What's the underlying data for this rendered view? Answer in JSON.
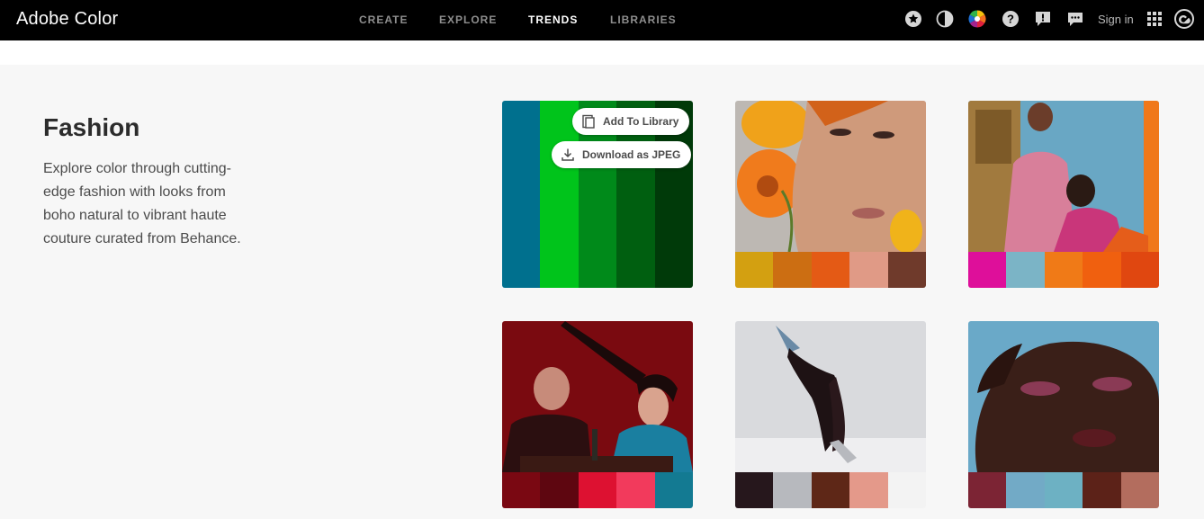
{
  "app": {
    "brand": "Adobe Color"
  },
  "nav": {
    "items": [
      {
        "label": "CREATE",
        "active": false
      },
      {
        "label": "EXPLORE",
        "active": false
      },
      {
        "label": "TRENDS",
        "active": true
      },
      {
        "label": "LIBRARIES",
        "active": false
      }
    ]
  },
  "header_icons": [
    "star-icon",
    "theme-contrast-icon",
    "color-wheel-icon",
    "help-icon",
    "feedback-icon",
    "chat-icon"
  ],
  "header": {
    "signin_label": "Sign in",
    "apps_icon": "apps-grid-icon",
    "cc_icon": "creative-cloud-icon"
  },
  "section": {
    "title": "Fashion",
    "description": "Explore color through cutting-edge fashion with looks from boho natural to vibrant haute couture curated from Behance."
  },
  "card_actions": {
    "add_to_library": "Add To Library",
    "download_jpeg": "Download as JPEG"
  },
  "cards": [
    {
      "swatches": [
        "#00708e",
        "#00c41b",
        "#008a1a",
        "#005f10",
        "#003a09"
      ],
      "hovered": true
    },
    {
      "swatches": [
        "#d3a011",
        "#cc6e12",
        "#e45a15",
        "#e09a86",
        "#6f3a2b"
      ]
    },
    {
      "swatches": [
        "#de0f9a",
        "#7bb4c6",
        "#f07a17",
        "#f0600f",
        "#e04710"
      ]
    },
    {
      "swatches": [
        "#7a0812",
        "#5e0610",
        "#dd1131",
        "#f23a5c",
        "#137a92"
      ]
    },
    {
      "swatches": [
        "#26171c",
        "#b7b9be",
        "#5e2717",
        "#e4998a",
        "#f3f3f3"
      ]
    },
    {
      "swatches": [
        "#7c2434",
        "#72aac6",
        "#6db1c3",
        "#5c2218",
        "#b36d5e"
      ]
    }
  ]
}
